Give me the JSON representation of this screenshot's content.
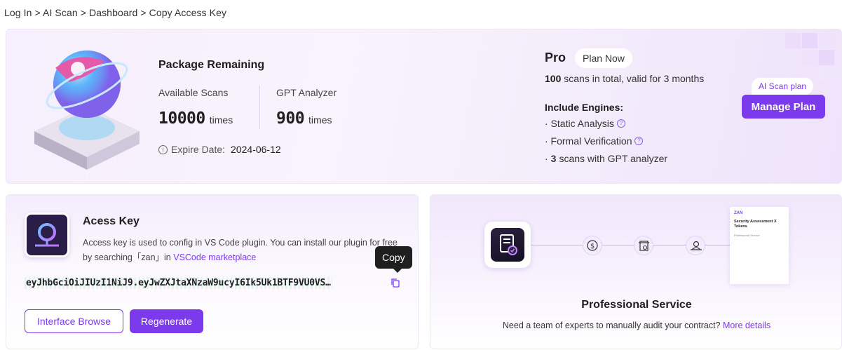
{
  "breadcrumb": "Log In > AI Scan > Dashboard > Copy Access Key",
  "package": {
    "title": "Package Remaining",
    "available_label": "Available Scans",
    "available_value": "10000",
    "available_unit": "times",
    "gpt_label": "GPT Analyzer",
    "gpt_value": "900",
    "gpt_unit": "times",
    "expire_label": "Expire Date:",
    "expire_date": "2024-06-12"
  },
  "plan": {
    "name": "Pro",
    "plan_now_label": "Plan Now",
    "scans_total_number": "100",
    "scans_total_text": "scans in total, valid for 3 months",
    "engines_title": "Include Engines:",
    "engine_1": "· Static Analysis",
    "engine_2": "· Formal Verification",
    "engine_3_prefix": "·",
    "engine_3_number": "3",
    "engine_3_text": "scans with GPT analyzer",
    "ai_scan_tag": "AI Scan plan",
    "manage_label": "Manage Plan"
  },
  "access_key": {
    "title": "Acess Key",
    "desc_part1": "Access key is used to config in VS Code plugin. You can install our plugin for free by searching「zan」in ",
    "desc_link": "VSCode marketplace",
    "value": "eyJhbGciOiJIUzI1NiJ9.eyJwZXJtaXNzaW9ucyI6Ik5Uk1BTF9VU0VS…",
    "tooltip": "Copy",
    "interface_browse_label": "Interface Browse",
    "regenerate_label": "Regenerate"
  },
  "service": {
    "doc_brand": "ZAN",
    "doc_title": "Security Assessment X Tokens",
    "doc_sub": "Professional Service",
    "title": "Professional Service",
    "desc": "Need a team of experts to manually audit your contract?",
    "link": "More details"
  },
  "colors": {
    "accent": "#7c3aed",
    "card_bg": "#f6effd"
  }
}
